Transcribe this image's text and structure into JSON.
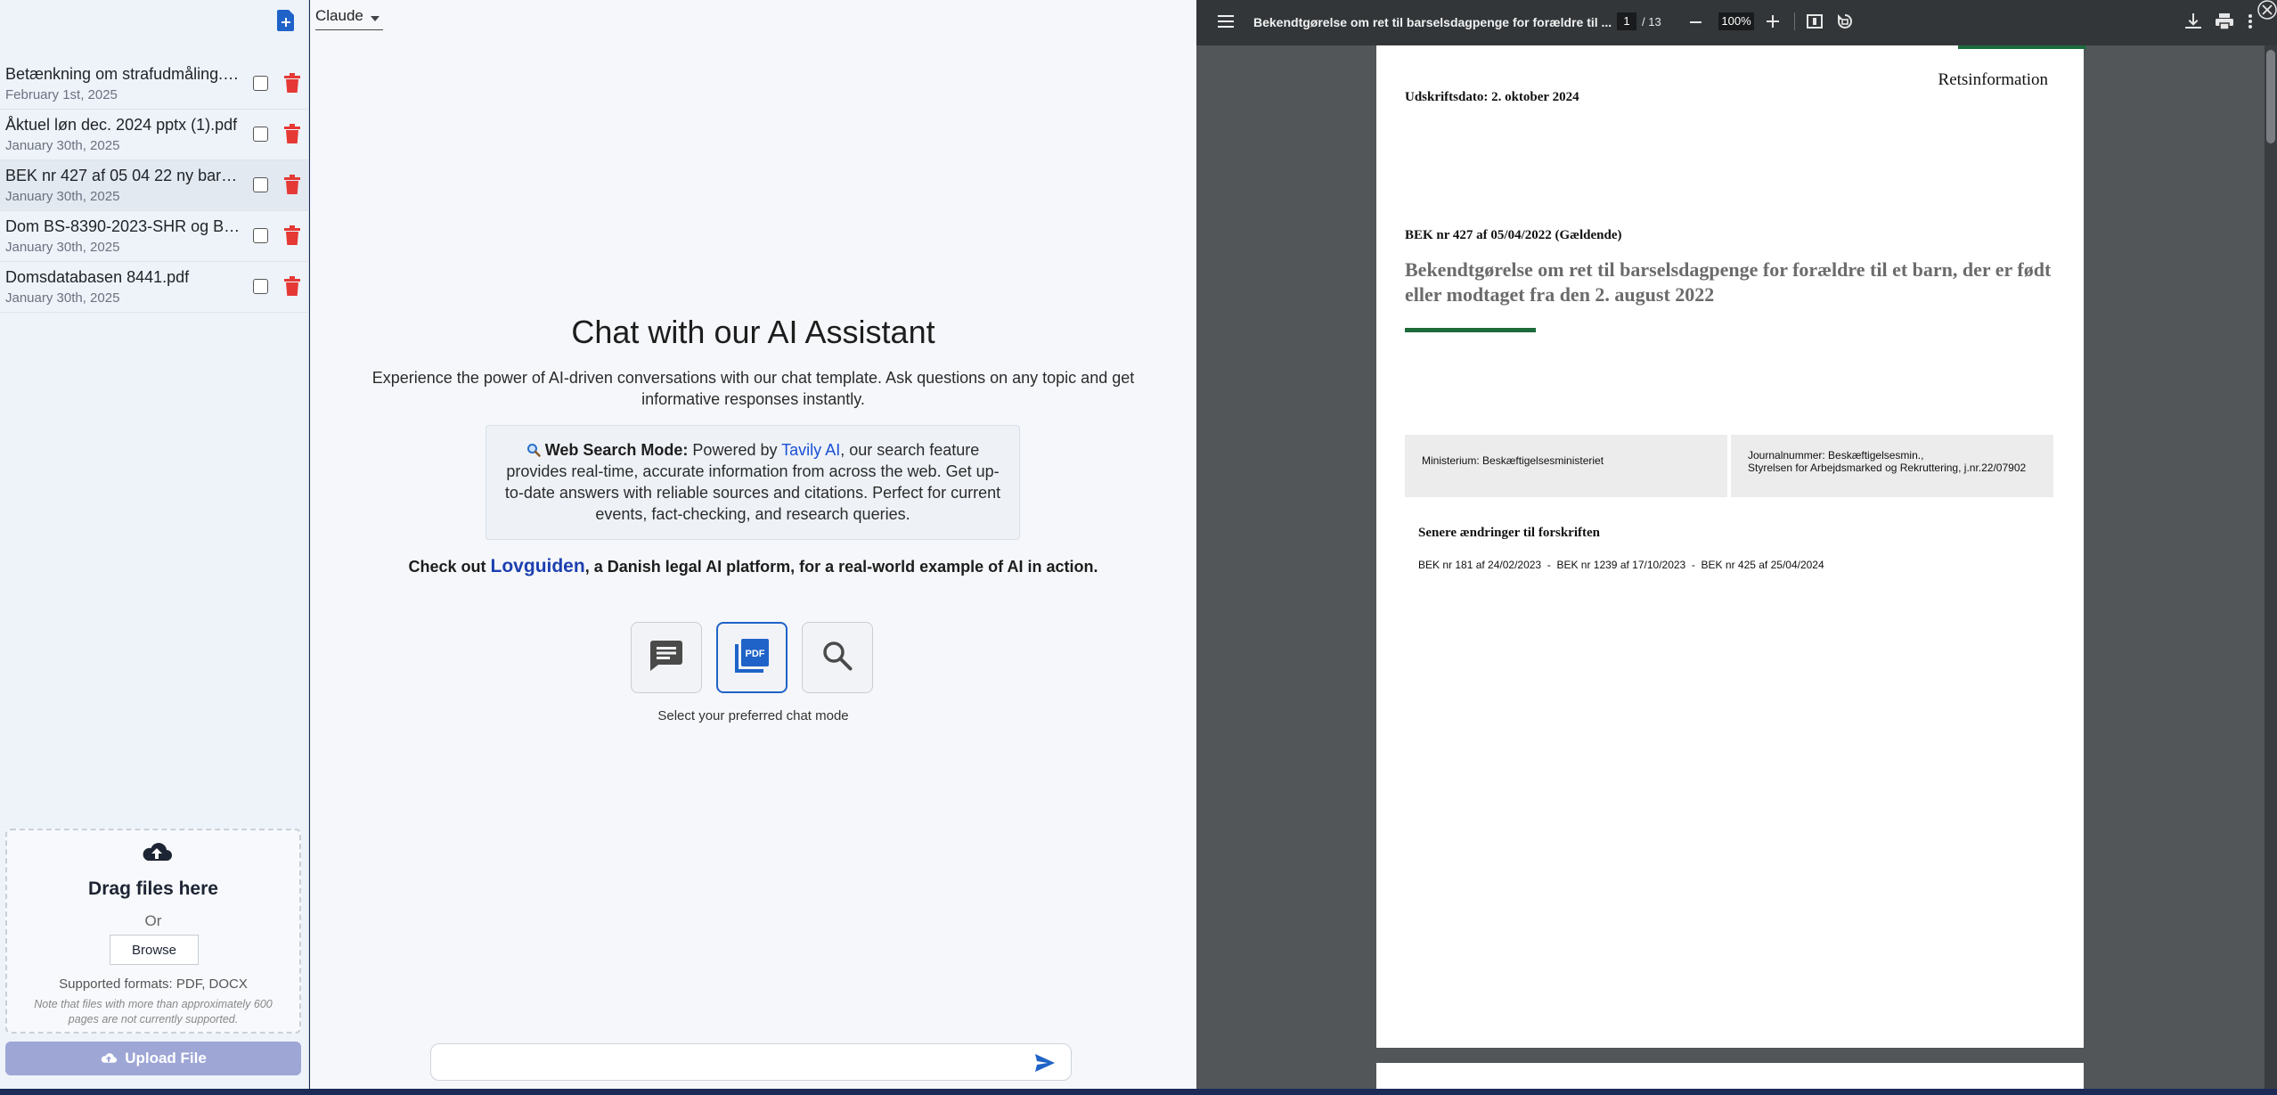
{
  "sidebar": {
    "files": [
      {
        "name": "Betænkning om strafudmåling.pdf",
        "date": "February 1st, 2025"
      },
      {
        "name": "Åktuel løn dec. 2024 pptx (1).pdf",
        "date": "January 30th, 2025"
      },
      {
        "name": "BEK nr 427 af 05 04 22 ny bars...",
        "date": "January 30th, 2025"
      },
      {
        "name": "Dom BS-8390-2023-SHR og BS...",
        "date": "January 30th, 2025"
      },
      {
        "name": "Domsdatabasen 8441.pdf",
        "date": "January 30th, 2025"
      }
    ],
    "upload": {
      "drag_title": "Drag files here",
      "or": "Or",
      "browse": "Browse",
      "formats": "Supported formats: PDF, DOCX",
      "note": "Note that files with more than approximately 600 pages are not currently supported.",
      "button": "Upload File"
    }
  },
  "main": {
    "model": "Claude",
    "title": "Chat with our AI Assistant",
    "description": "Experience the power of AI-driven conversations with our chat template. Ask questions on any topic and get informative responses instantly.",
    "web_search": {
      "label": "Web Search Mode:",
      "prefix": "Powered by",
      "link": "Tavily AI",
      "text": ", our search feature provides real-time, accurate information from across the web. Get up-to-date answers with reliable sources and citations. Perfect for current events, fact-checking, and research queries."
    },
    "check_out": {
      "prefix": "Check out",
      "brand": "Lovguiden",
      "suffix": ", a Danish legal AI platform, for a real-world example of AI in action."
    },
    "modes": [
      {
        "name": "chat",
        "icon": "chat-icon",
        "selected": false
      },
      {
        "name": "pdf",
        "icon": "pdf-icon",
        "selected": true
      },
      {
        "name": "search",
        "icon": "search-icon",
        "selected": false
      }
    ],
    "mode_caption": "Select your preferred chat mode",
    "input_placeholder": ""
  },
  "pdf_viewer": {
    "title": "Bekendtgørelse om ret til barselsdagpenge for forældre til ...",
    "page_current": "1",
    "page_total": "/ 13",
    "zoom": "100%",
    "page": {
      "header_right": "Retsinformation",
      "print_date": "Udskriftsdato: 2. oktober 2024",
      "bek_line": "BEK nr 427 af 05/04/2022 (Gældende)",
      "doc_title": "Bekendtgørelse om ret til barselsdagpenge for forældre til et barn, der er født eller modtaget fra den 2. august 2022",
      "ministry": "Ministerium: Beskæftigelsesministeriet",
      "journal_1": "Journalnummer: Beskæftigelsesmin.,",
      "journal_2": "Styrelsen for Arbejdsmarked og Rekruttering, j.nr.22/07902",
      "changes_title": "Senere ændringer til forskriften",
      "changes": "BEK nr 181 af 24/02/2023  -  BEK nr 1239 af 17/10/2023  -  BEK nr 425 af 25/04/2024"
    }
  },
  "colors": {
    "accent": "#1f63c8",
    "trash": "#e53935",
    "upload_button": "#9ea6d6",
    "doc_green": "#1d6b3a"
  }
}
